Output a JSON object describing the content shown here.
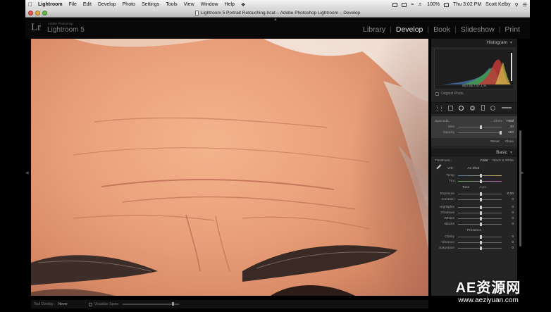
{
  "menubar": {
    "app": "Lightroom",
    "items": [
      "File",
      "Edit",
      "Develop",
      "Photo",
      "Settings",
      "Tools",
      "View",
      "Window",
      "Help"
    ],
    "battery": "100%",
    "clock": "Thu 3:02 PM",
    "user": "Scott Kelby"
  },
  "window": {
    "title": "Lightroom 5 Portrait Retouching.lrcat – Adobe Photoshop Lightroom – Develop"
  },
  "identity": {
    "logo": "Lr",
    "company": "Adobe Photoshop",
    "product": "Lightroom 5"
  },
  "modules": {
    "library": "Library",
    "develop": "Develop",
    "book": "Book",
    "slideshow": "Slideshow",
    "print": "Print"
  },
  "toolbar": {
    "overlay_label": "Tool Overlay :",
    "overlay_value": "Never",
    "visualize": "Visualize Spots"
  },
  "panel": {
    "histogram_title": "Histogram",
    "histogram_values": "66.5   55.7   57.1 %",
    "original_photo": "Original Photo",
    "spot": {
      "title": "Spot Edit :",
      "clone": "Clone",
      "heal": "Heal",
      "size_label": "Size",
      "size_value": "40",
      "size_pct": 0.55,
      "opacity_label": "Opacity",
      "opacity_value": "100",
      "opacity_pct": 1.0,
      "reset": "Reset",
      "close": "Close"
    },
    "basic": {
      "title": "Basic",
      "treatment_label": "Treatment :",
      "color": "Color",
      "bw": "Black & White",
      "wb_label": "WB :",
      "wb_value": "As Shot",
      "temp": "Temp",
      "tint": "Tint",
      "tone": "Tone",
      "auto": "Auto",
      "exposure": "Exposure",
      "exposure_value": "0.00",
      "contrast": "Contrast",
      "contrast_value": "0",
      "highlights": "Highlights",
      "shadows": "Shadows",
      "whites": "Whites",
      "blacks": "Blacks",
      "presence": "Presence",
      "clarity": "Clarity",
      "vibrance": "Vibrance",
      "saturation": "Saturation",
      "zero": "0"
    }
  },
  "watermark": {
    "brand": "AE资源网",
    "url": "www.aeziyuan.com"
  }
}
